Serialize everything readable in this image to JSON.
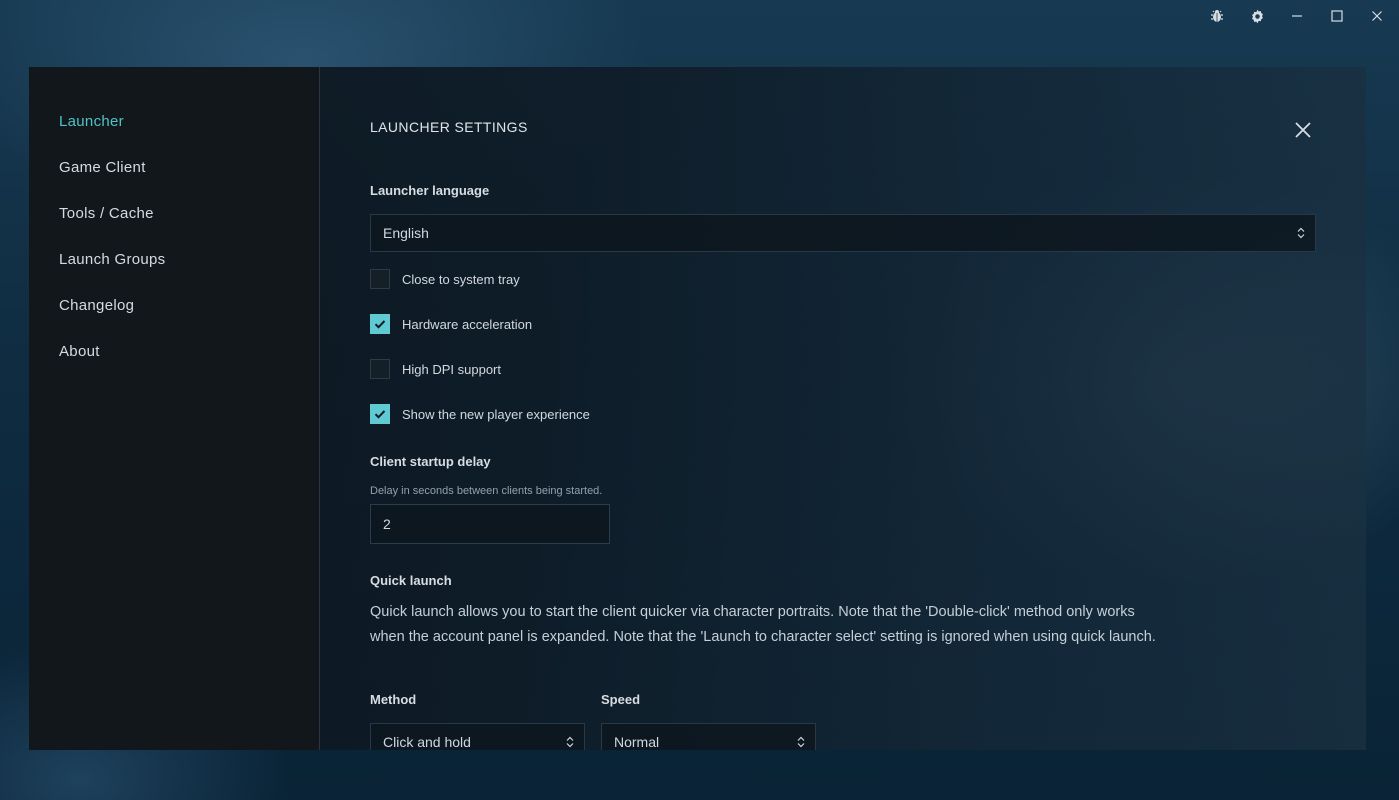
{
  "window": {
    "icons": [
      "bug-icon",
      "gear-icon",
      "minimize-icon",
      "maximize-icon",
      "close-icon"
    ]
  },
  "sidebar": {
    "items": [
      {
        "label": "Launcher",
        "active": true
      },
      {
        "label": "Game Client"
      },
      {
        "label": "Tools / Cache"
      },
      {
        "label": "Launch Groups"
      },
      {
        "label": "Changelog"
      },
      {
        "label": "About"
      }
    ]
  },
  "settings": {
    "title": "LAUNCHER SETTINGS",
    "language": {
      "label": "Launcher language",
      "value": "English"
    },
    "options": [
      {
        "label": "Close to system tray",
        "checked": false
      },
      {
        "label": "Hardware acceleration",
        "checked": true
      },
      {
        "label": "High DPI support",
        "checked": false
      },
      {
        "label": "Show the new player experience",
        "checked": true
      }
    ],
    "startup_delay": {
      "label": "Client startup delay",
      "hint": "Delay in seconds between clients being started.",
      "value": "2"
    },
    "quick_launch": {
      "label": "Quick launch",
      "description": "Quick launch allows you to start the client quicker via character portraits. Note that the 'Double-click' method only works when the account panel is expanded. Note that the 'Launch to character select' setting is ignored when using quick launch.",
      "method": {
        "label": "Method",
        "value": "Click and hold"
      },
      "speed": {
        "label": "Speed",
        "value": "Normal"
      }
    }
  },
  "colors": {
    "accent": "#4fc3c7",
    "checkbox": "#5fcad1"
  }
}
